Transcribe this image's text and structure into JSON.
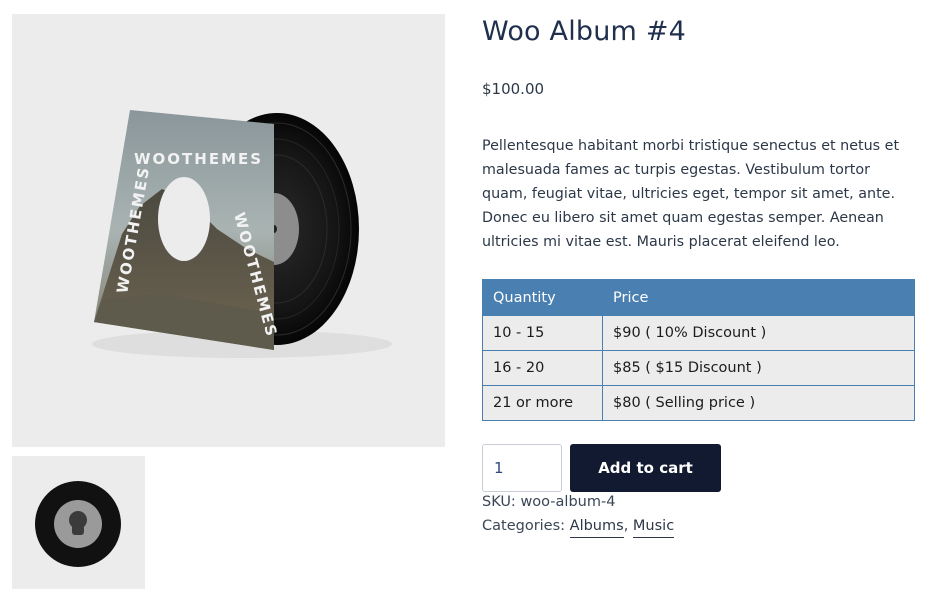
{
  "product": {
    "title": "Woo Album #4",
    "price": "$100.00",
    "description": "Pellentesque habitant morbi tristique senectus et netus et malesuada fames ac turpis egestas. Vestibulum tortor quam, feugiat vitae, ultricies eget, tempor sit amet, ante. Donec eu libero sit amet quam egestas semper. Aenean ultricies mi vitae est. Mauris placerat eleifend leo.",
    "cover_text": "WOOTHEMES WOOTHEMES WOOTHEMES"
  },
  "pricing_table": {
    "headers": [
      "Quantity",
      "Price"
    ],
    "rows": [
      [
        "10 - 15",
        "$90 ( 10% Discount )"
      ],
      [
        "16 - 20",
        "$85 ( $15 Discount )"
      ],
      [
        "21 or more",
        "$80 ( Selling price )"
      ]
    ]
  },
  "cart": {
    "quantity": "1",
    "button_label": "Add to cart"
  },
  "meta": {
    "sku_label": "SKU:",
    "sku": "woo-album-4",
    "categories_label": "Categories:",
    "categories": [
      "Albums",
      "Music"
    ],
    "separator": ","
  }
}
